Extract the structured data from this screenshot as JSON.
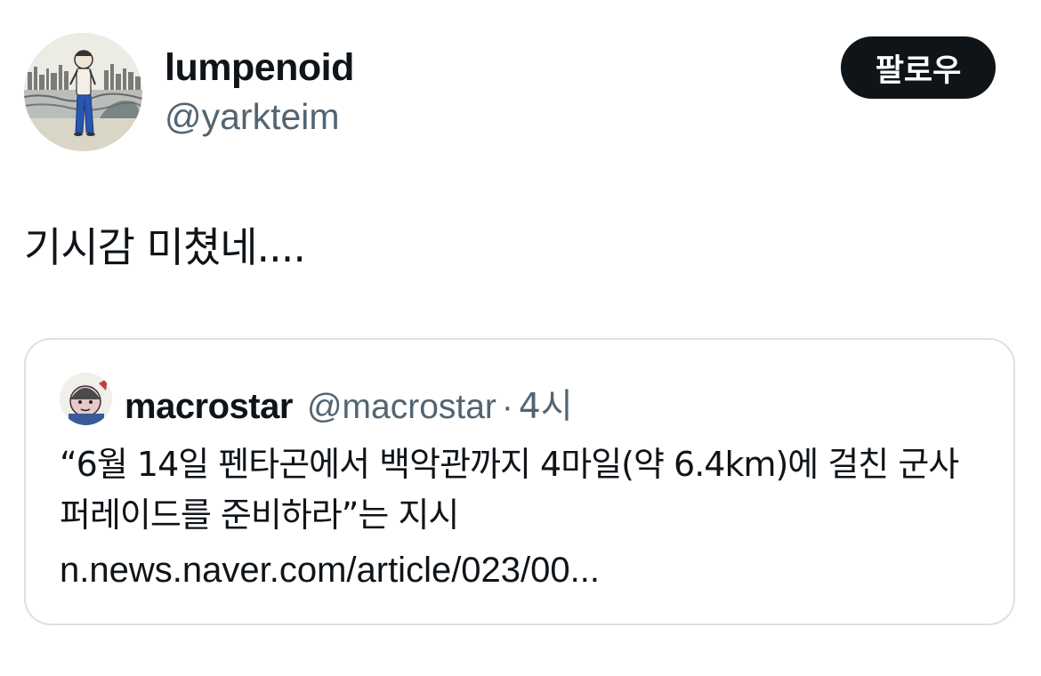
{
  "author": {
    "display_name": "lumpenoid",
    "handle": "@yarkteim",
    "avatar_icon": "illustrated-figure-avatar"
  },
  "follow_button_label": "팔로우",
  "tweet_text": "기시감 미쳤네....",
  "quoted_tweet": {
    "display_name": "macrostar",
    "handle": "@macrostar",
    "separator": "·",
    "time": "4시",
    "text": "“6월 14일 펜타곤에서 백악관까지 4마일(약 6.4km)에 걸친 군사 퍼레이드를 준비하라”는 지시",
    "link": "n.news.naver.com/article/023/00...",
    "avatar_icon": "illustrated-avatar"
  },
  "colors": {
    "text": "#0f1419",
    "secondary_text": "#536471",
    "button_bg": "#0f1419",
    "border": "#dbe1e6"
  }
}
